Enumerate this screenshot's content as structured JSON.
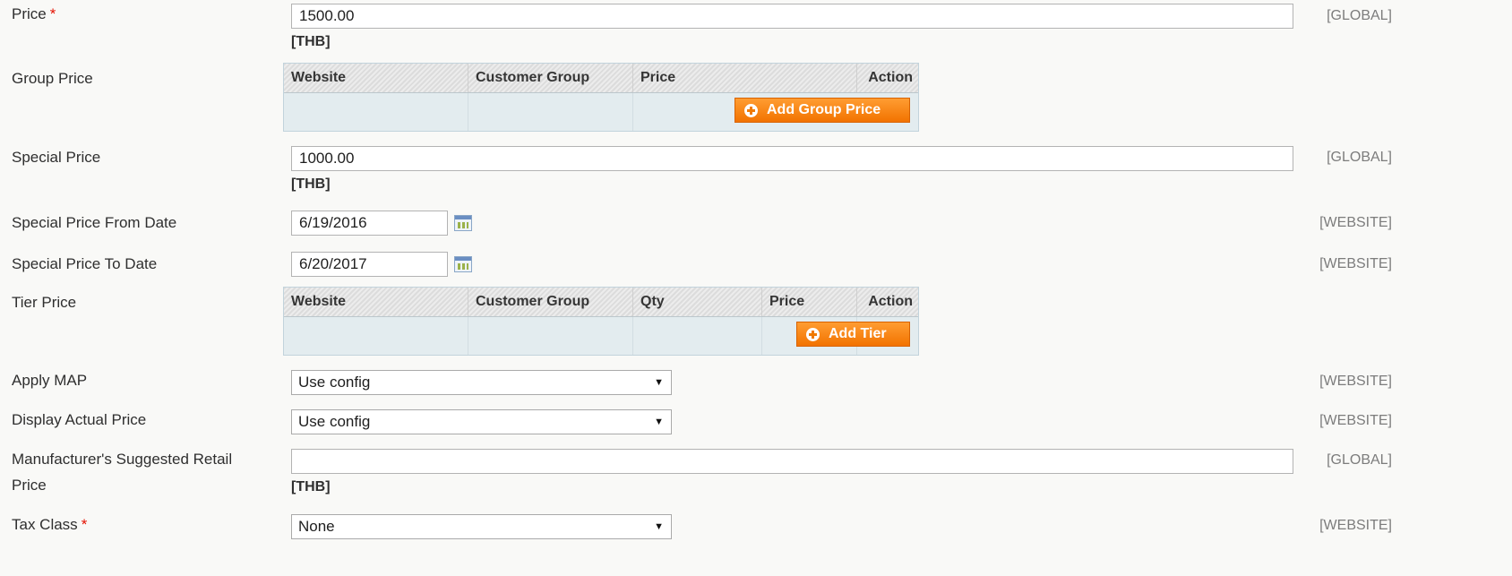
{
  "price": {
    "label": "Price",
    "required": "*",
    "value": "1500.00",
    "currency": "[THB]",
    "scope": "[GLOBAL]"
  },
  "group_price": {
    "label": "Group Price",
    "columns": [
      "Website",
      "Customer Group",
      "Price",
      "Action"
    ],
    "add_button": "Add Group Price"
  },
  "special_price": {
    "label": "Special Price",
    "value": "1000.00",
    "currency": "[THB]",
    "scope": "[GLOBAL]"
  },
  "special_from": {
    "label": "Special Price From Date",
    "value": "6/19/2016",
    "scope": "[WEBSITE]",
    "icon": "calendar-icon"
  },
  "special_to": {
    "label": "Special Price To Date",
    "value": "6/20/2017",
    "scope": "[WEBSITE]",
    "icon": "calendar-icon"
  },
  "tier_price": {
    "label": "Tier Price",
    "columns": [
      "Website",
      "Customer Group",
      "Qty",
      "Price",
      "Action"
    ],
    "add_button": "Add Tier"
  },
  "apply_map": {
    "label": "Apply MAP",
    "selected": "Use config",
    "scope": "[WEBSITE]"
  },
  "display_actual": {
    "label": "Display Actual Price",
    "selected": "Use config",
    "scope": "[WEBSITE]"
  },
  "msrp": {
    "label_line1": "Manufacturer's Suggested Retail",
    "label_line2": "Price",
    "value": "",
    "currency": "[THB]",
    "scope": "[GLOBAL]"
  },
  "tax_class": {
    "label": "Tax Class",
    "required": "*",
    "selected": "None",
    "scope": "[WEBSITE]"
  },
  "colors": {
    "button": "#f27300",
    "required": "#e41101",
    "scope_text": "#7c7c7c"
  }
}
